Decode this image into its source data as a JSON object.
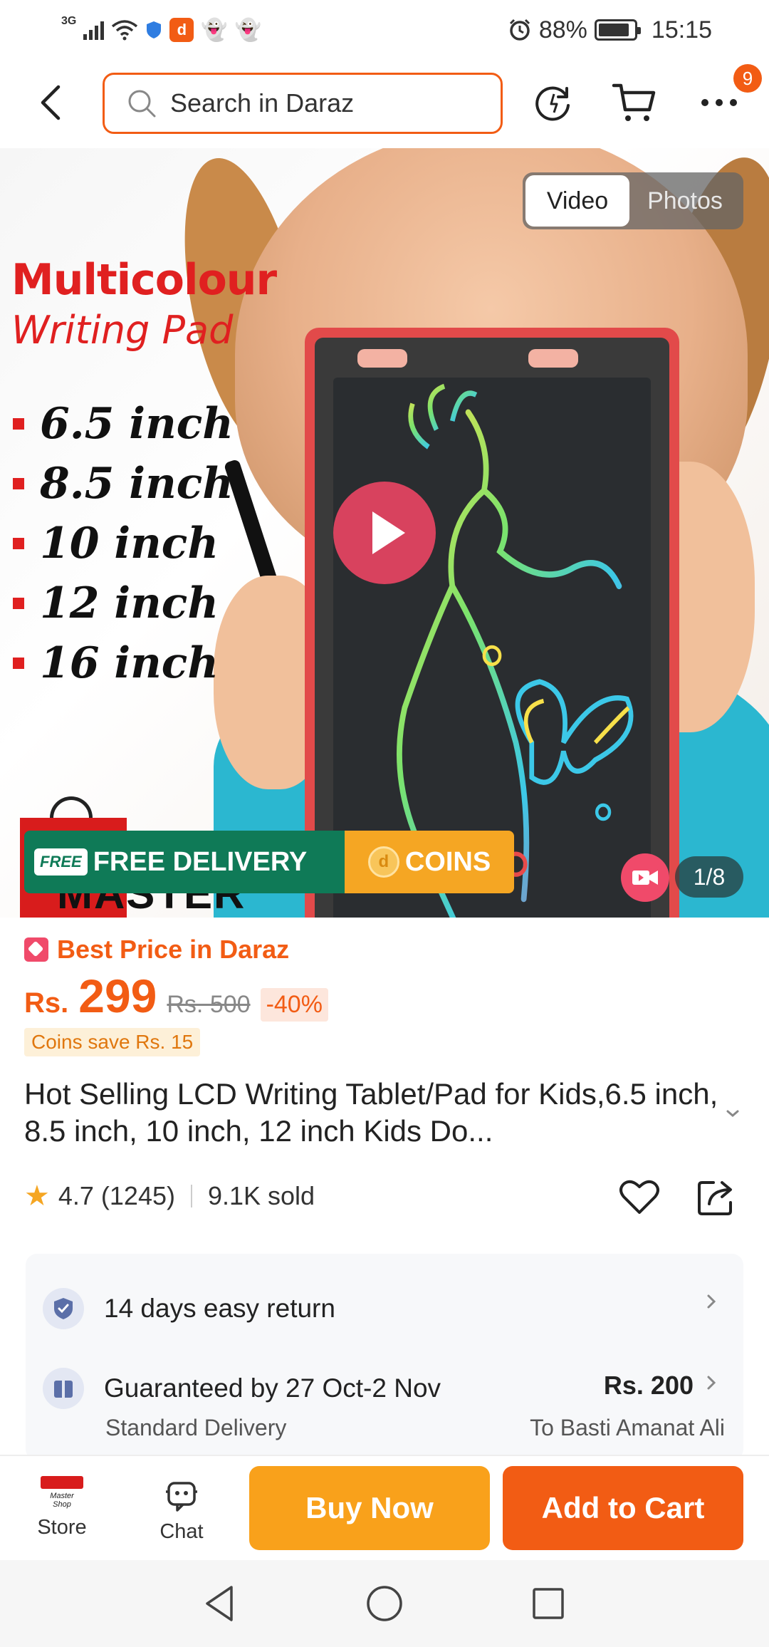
{
  "status_bar": {
    "network": "3G",
    "battery": "88%",
    "battery_level": 0.88,
    "time": "15:15"
  },
  "topnav": {
    "search_placeholder": "Search in Daraz",
    "more_badge": "9",
    "icons": [
      "back-icon",
      "search-icon",
      "history-icon",
      "cart-icon",
      "more-icon"
    ]
  },
  "hero": {
    "promo_title": "Multicolour",
    "promo_subtitle": "Writing Pad",
    "sizes": [
      "6.5 inch",
      "8.5 inch",
      "10 inch",
      "12 inch",
      "16 inch"
    ],
    "media_toggle": {
      "video": "Video",
      "photos": "Photos"
    },
    "free_delivery_tag": "FREE",
    "free_delivery": "FREE DELIVERY",
    "coins": "COINS",
    "brand": "MASTER",
    "counter": "1/8"
  },
  "price": {
    "badge": "Best Price in Daraz",
    "currency": "Rs.",
    "value": "299",
    "original": "Rs. 500",
    "discount": "-40%",
    "coins_save": "Coins save Rs. 15"
  },
  "product": {
    "title": "Hot Selling LCD Writing Tablet/Pad for Kids,6.5 inch,  8.5 inch, 10 inch, 12 inch Kids Do...",
    "rating": "4.7 (1245)",
    "sold": "9.1K sold"
  },
  "info": {
    "return_text": "14 days easy return",
    "delivery_text": "Guaranteed by 27 Oct-2 Nov",
    "delivery_sub": "Standard Delivery",
    "delivery_price": "Rs. 200",
    "delivery_to": "To Basti Amanat Ali"
  },
  "bottom_bar": {
    "store_label": "Store",
    "store_logo_text": "Master Shop",
    "chat_label": "Chat",
    "buy_now": "Buy Now",
    "add_to_cart": "Add to Cart"
  },
  "colors": {
    "accent": "#f25c14",
    "buy_now": "#f9a11b",
    "free_delivery": "#0f7a57",
    "coins": "#f5a623"
  }
}
